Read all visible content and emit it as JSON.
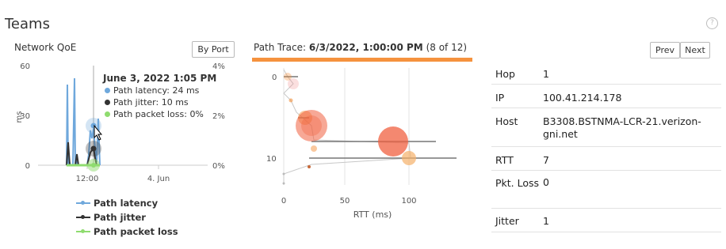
{
  "app": {
    "title": "Teams",
    "help_icon": "?"
  },
  "qoe": {
    "title": "Network QoE",
    "by_port_label": "By Port",
    "y_left_label": "ms",
    "y_left_ticks": [
      "60",
      "30",
      "0"
    ],
    "y_right_ticks": [
      "4%",
      "2%",
      "0%"
    ],
    "x_ticks": [
      "12:00",
      "4. Jun"
    ],
    "tooltip": {
      "title": "June 3, 2022 1:05 PM",
      "latency": "Path latency: 24 ms",
      "jitter": "Path jitter: 10 ms",
      "loss": "Path packet loss: 0%"
    },
    "legend": [
      {
        "label": "Path latency",
        "color": "#6fa8dc"
      },
      {
        "label": "Path jitter",
        "color": "#333333"
      },
      {
        "label": "Path packet loss",
        "color": "#8fdc6f"
      }
    ]
  },
  "trace": {
    "label": "Path Trace:",
    "date": "6/3/2022, 1:00:00 PM",
    "count": "(8 of 12)",
    "prev_label": "Prev",
    "next_label": "Next",
    "y_ticks": [
      "0",
      "10"
    ],
    "x_ticks": [
      "0",
      "50",
      "100"
    ],
    "x_label": "RTT (ms)",
    "accent": "#f5923e"
  },
  "hop": {
    "rows": [
      {
        "key": "Hop",
        "value": "1"
      },
      {
        "key": "IP",
        "value": "100.41.214.178"
      },
      {
        "key": "Host",
        "value": "B3308.BSTNMA-LCR-21.verizon-gni.net"
      },
      {
        "key": "RTT",
        "value": "7"
      },
      {
        "key": "Pkt. Loss",
        "value": "0"
      },
      {
        "key": "Jitter",
        "value": "1"
      }
    ]
  }
}
